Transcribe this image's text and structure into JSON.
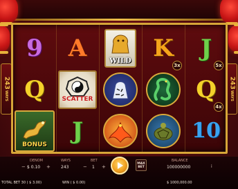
{
  "side_panels": {
    "ways_number": "243",
    "ways_word": "WAYS"
  },
  "reels": {
    "col1": [
      "9",
      "Q",
      "BONUS"
    ],
    "col2": [
      "A",
      "SCATTER",
      "J"
    ],
    "col3": [
      "WILD",
      "tiger-icon",
      "phoenix-icon"
    ],
    "col4": [
      "K",
      "dragon-icon",
      "turtle-icon"
    ],
    "col5": [
      "J",
      "Q",
      "10"
    ]
  },
  "symbol_labels": {
    "wild": "WILD",
    "scatter": "SCATTER",
    "bonus": "BONUS"
  },
  "multipliers": {
    "reel4_row1": "3x",
    "reel5_row1": "5x",
    "reel5_row2": "4x"
  },
  "controls": {
    "denom_label": "DENOM",
    "denom_value": "$ 0.10",
    "ways_label": "WAYS",
    "ways_value": "243",
    "bet_label": "BET",
    "bet_value": "1",
    "balance_label": "BALANCE",
    "balance_value": "100000000",
    "balance_currency": "$ 1000,000.00",
    "total_bet_label": "TOTAL BET 30 ( $ 3.00)",
    "win_label": "WIN ( $ 0.00)",
    "max_bet_line1": "MAX",
    "max_bet_line2": "BET",
    "minus": "−",
    "plus": "+",
    "info": "i"
  },
  "colors": {
    "frame_gold": "#d7a638",
    "background_red": "#5a0d10",
    "spin_orange": "#f0a020"
  }
}
